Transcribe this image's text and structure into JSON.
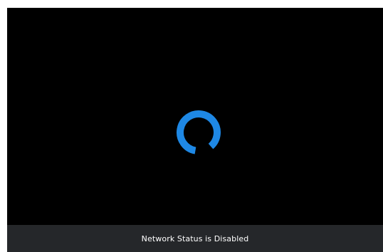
{
  "status": {
    "message": "Network Status is Disabled"
  },
  "colors": {
    "background": "#000000",
    "spinner": "#1e88e5",
    "status_bar": "#25272a",
    "status_text": "#ffffff"
  },
  "icons": {
    "spinner": "loading-spinner-icon"
  }
}
